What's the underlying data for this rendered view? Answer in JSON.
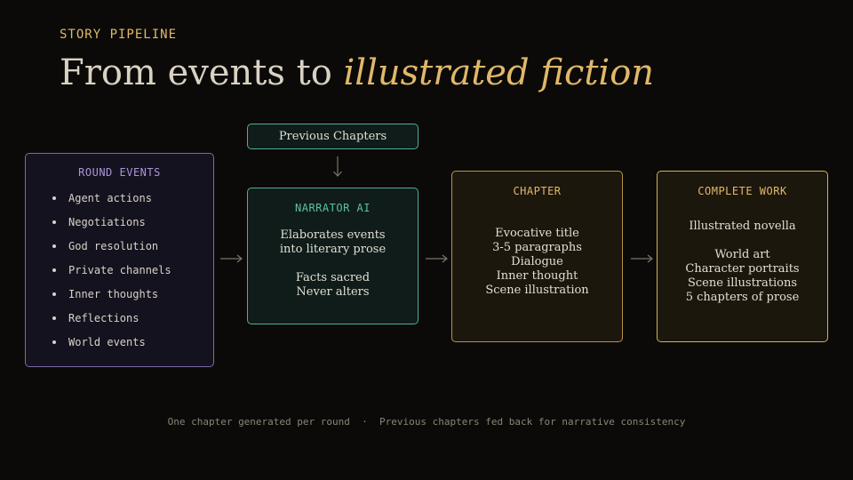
{
  "header": {
    "eyebrow": "STORY PIPELINE",
    "title_plain": "From events to ",
    "title_accent": "illustrated fiction"
  },
  "round_events": {
    "label": "ROUND EVENTS",
    "items": [
      "Agent actions",
      "Negotiations",
      "God resolution",
      "Private channels",
      "Inner thoughts",
      "Reflections",
      "World events"
    ]
  },
  "previous_chapters": {
    "label": "Previous Chapters"
  },
  "narrator": {
    "label": "NARRATOR AI",
    "line1": "Elaborates events",
    "line2": "into literary prose",
    "line3": "Facts sacred",
    "line4": "Never alters"
  },
  "chapter": {
    "label": "CHAPTER",
    "items": [
      "Evocative title",
      "3-5 paragraphs",
      "Dialogue",
      "Inner thought",
      "Scene illustration"
    ]
  },
  "complete_work": {
    "label": "COMPLETE WORK",
    "lead": "Illustrated novella",
    "items": [
      "World art",
      "Character portraits",
      "Scene illustrations",
      "5 chapters of prose"
    ]
  },
  "footer": {
    "left": "One chapter generated per round",
    "separator": "·",
    "right": "Previous chapters fed back for narrative consistency"
  },
  "colors": {
    "accent_gold": "#e0b86a",
    "teal": "#4fae98",
    "purple": "#7d6aa8",
    "background": "#0b0a08"
  }
}
